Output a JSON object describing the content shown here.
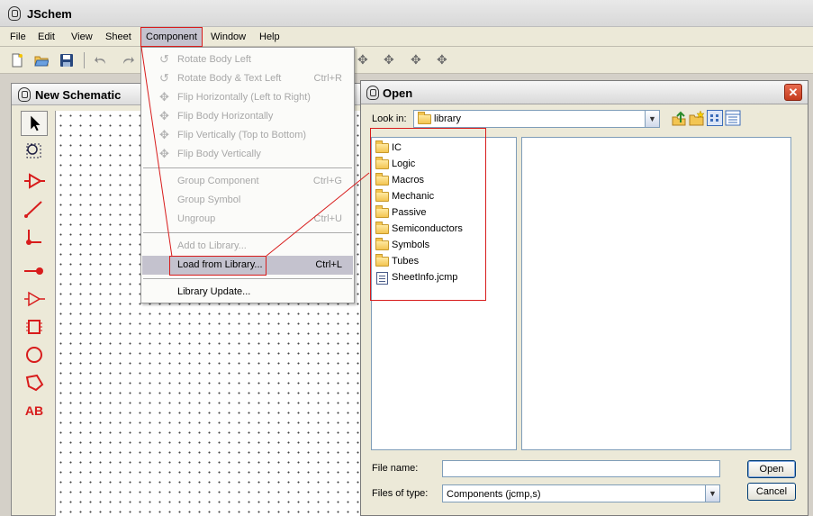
{
  "app": {
    "title": "JSchem"
  },
  "menubar": {
    "items": [
      {
        "label": "File"
      },
      {
        "label": "Edit"
      },
      {
        "label": "View"
      },
      {
        "label": "Sheet"
      },
      {
        "label": "Component"
      },
      {
        "label": "Window"
      },
      {
        "label": "Help"
      }
    ],
    "active_index": 4
  },
  "toolbar": {
    "icons": [
      "new-file-icon",
      "open-folder-icon",
      "save-icon",
      "undo-icon",
      "redo-icon",
      "flip-horizontal-icon",
      "flip-body-horizontal-icon",
      "flip-vertical-icon",
      "flip-body-vertical-icon"
    ]
  },
  "component_menu": {
    "items": [
      {
        "label": "Rotate Body Left",
        "accel": "",
        "enabled": false,
        "icon": "rotate-left-icon"
      },
      {
        "label": "Rotate Body & Text Left",
        "accel": "Ctrl+R",
        "enabled": false,
        "icon": "rotate-text-left-icon"
      },
      {
        "label": "Flip Horizontally (Left to Right)",
        "accel": "",
        "enabled": false,
        "icon": "flip-horizontal-icon"
      },
      {
        "label": "Flip Body Horizontally",
        "accel": "",
        "enabled": false,
        "icon": "flip-body-horizontal-icon"
      },
      {
        "label": "Flip Vertically (Top to Bottom)",
        "accel": "",
        "enabled": false,
        "icon": "flip-vertical-icon"
      },
      {
        "label": "Flip Body Vertically",
        "accel": "",
        "enabled": false,
        "icon": "flip-body-vertical-icon"
      },
      {
        "label": "Group Component",
        "accel": "Ctrl+G",
        "enabled": false
      },
      {
        "label": "Group Symbol",
        "accel": "",
        "enabled": false
      },
      {
        "label": "Ungroup",
        "accel": "Ctrl+U",
        "enabled": false
      },
      {
        "label": "Add to Library...",
        "accel": "",
        "enabled": false
      },
      {
        "label": "Load from Library...",
        "accel": "Ctrl+L",
        "enabled": true,
        "highlighted": true
      },
      {
        "label": "Library Update...",
        "accel": "",
        "enabled": true
      }
    ]
  },
  "schematic": {
    "title": "New Schematic",
    "palette": [
      "select-arrow-icon",
      "zoom-select-icon",
      "buffer-icon",
      "wire-icon",
      "junction-icon",
      "pin-icon",
      "triangle-icon",
      "chip-icon",
      "circle-icon",
      "polygon-icon"
    ],
    "text_tool_label": "AB"
  },
  "open_dialog": {
    "title": "Open",
    "look_in_label": "Look in:",
    "look_in_value": "library",
    "files": [
      {
        "name": "IC",
        "type": "folder"
      },
      {
        "name": "Logic",
        "type": "folder"
      },
      {
        "name": "Macros",
        "type": "folder"
      },
      {
        "name": "Mechanic",
        "type": "folder"
      },
      {
        "name": "Passive",
        "type": "folder"
      },
      {
        "name": "Semiconductors",
        "type": "folder"
      },
      {
        "name": "Symbols",
        "type": "folder"
      },
      {
        "name": "Tubes",
        "type": "folder"
      },
      {
        "name": "SheetInfo.jcmp",
        "type": "file"
      }
    ],
    "file_name_label": "File name:",
    "file_name_value": "",
    "file_type_label": "Files of type:",
    "file_type_value": "Components (jcmp,s)",
    "open_label": "Open",
    "cancel_label": "Cancel",
    "close_glyph": "✕",
    "dropdown_glyph": "▼"
  },
  "colors": {
    "highlight_red": "#d81c1c",
    "menu_hover": "#c4c2ce",
    "disabled_text": "#a8a8a8",
    "folder_yellow": "#f3c552"
  }
}
